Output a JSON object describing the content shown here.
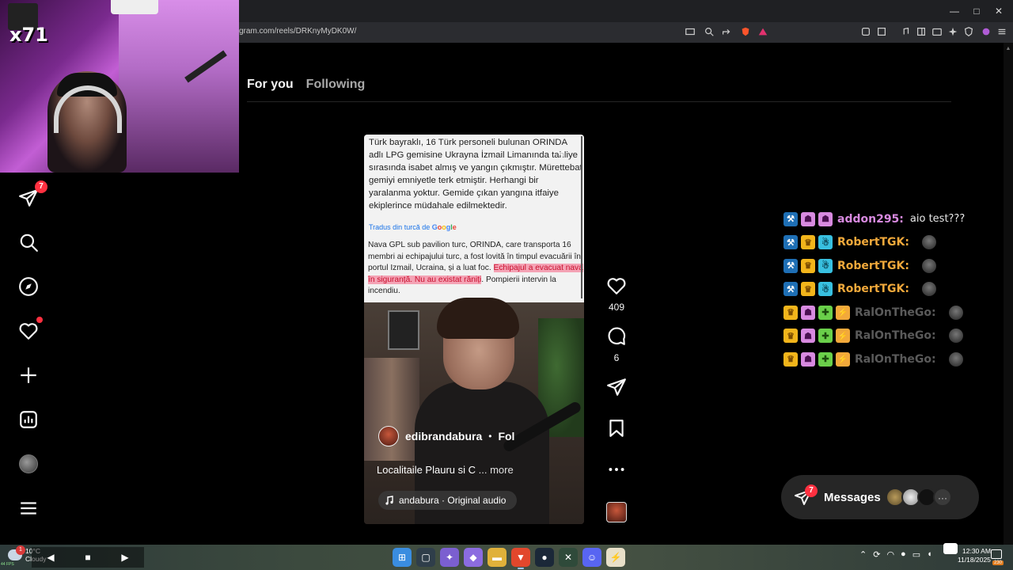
{
  "browser": {
    "url": "gram.com/reels/DRKnyMyDK0W/",
    "window_controls": [
      "—",
      "□",
      "✕"
    ]
  },
  "webcam": {
    "tag": "x71"
  },
  "tabs": {
    "for_you": "For you",
    "following": "Following"
  },
  "sidebar": {
    "items": [
      {
        "name": "direct-messages",
        "badge": "7"
      },
      {
        "name": "search"
      },
      {
        "name": "explore"
      },
      {
        "name": "notifications",
        "dot": true
      },
      {
        "name": "create"
      },
      {
        "name": "dashboard"
      },
      {
        "name": "profile"
      },
      {
        "name": "more"
      }
    ]
  },
  "reel": {
    "doc_turkish": "Türk bayraklı, 16 Türk personeli bulunan ORINDA adlı LPG gemisine Ukrayna İzmail Limanında tahliye sırasında isabet almış ve yangın çıkmıştır. Mürettebat gemiyi emniyetle terk etmiştir. Herhangi bir yaralanma yoktur. Gemide çıkan yangına itfaiye ekiplerince müdahale edilmektedir.",
    "google_prefix": "Tradus din turcă de ",
    "google_word": [
      "G",
      "o",
      "o",
      "g",
      "l",
      "e"
    ],
    "doc_ro_start": "Nava GPL sub pavilion turc, ORINDA, care transporta 16 membri ai echipajului turc, a fost lovită în timpul evacuării în portul Izmail, Ucraina, și a luat foc. ",
    "doc_ro_highlight": "Echipajul a evacuat nava în siguranță. Nu au existat răniți",
    "doc_ro_end": ". Pompierii intervin la incendiu.",
    "username": "edibrandabura",
    "dot": "•",
    "follow": "Fol",
    "caption": "Localitaile Plauru si C",
    "more": "... more",
    "audio": "andabura · Original audio"
  },
  "actions": {
    "likes": "409",
    "comments": "6"
  },
  "chat": {
    "lines": [
      {
        "name": "addon295:",
        "color": "#d88ae0",
        "msg": "aio test???",
        "badges": [
          "blue",
          "pink",
          "pink"
        ]
      },
      {
        "name": "RobertTGK:",
        "color": "#f2a93b",
        "msg": "",
        "badges": [
          "blue",
          "gold",
          "cyan"
        ]
      },
      {
        "name": "RobertTGK:",
        "color": "#f2a93b",
        "msg": "",
        "badges": [
          "blue",
          "gold",
          "cyan"
        ]
      },
      {
        "name": "RobertTGK:",
        "color": "#f2a93b",
        "msg": "",
        "badges": [
          "blue",
          "gold",
          "cyan"
        ]
      },
      {
        "name": "RalOnTheGo:",
        "color": "#5a5a5a",
        "msg": "",
        "badges": [
          "gold",
          "pink",
          "green",
          "orange"
        ]
      },
      {
        "name": "RalOnTheGo:",
        "color": "#5a5a5a",
        "msg": "",
        "badges": [
          "gold",
          "pink",
          "green",
          "orange"
        ]
      },
      {
        "name": "RalOnTheGo:",
        "color": "#5a5a5a",
        "msg": "",
        "badges": [
          "gold",
          "pink",
          "green",
          "orange"
        ]
      }
    ]
  },
  "messages": {
    "label": "Messages",
    "badge": "7",
    "more": "···"
  },
  "taskbar": {
    "weather_temp": "10°C",
    "weather_desc": "Cloudy",
    "weather_badge": "1",
    "fps": "44 FPS",
    "time": "12:30 AM",
    "date": "11/18/2025",
    "notif_badge": "230"
  },
  "colors": {
    "accent_red": "#ff3040",
    "highlight": "#f4a3b5"
  }
}
